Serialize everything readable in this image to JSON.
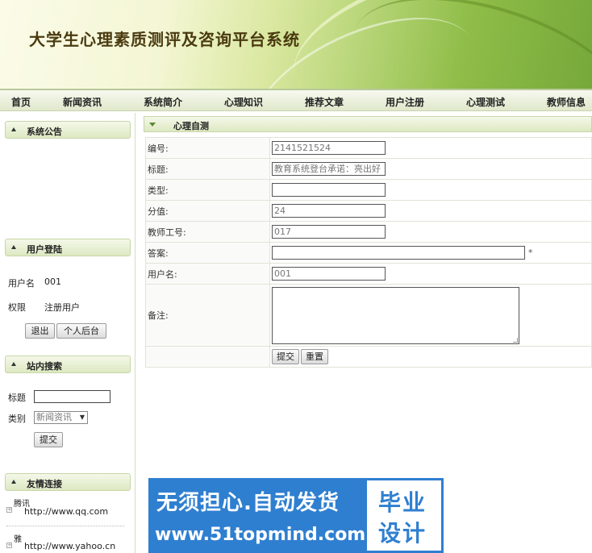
{
  "site": {
    "title": "大学生心理素质测评及咨询平台系统"
  },
  "nav": [
    "首页",
    "新闻资讯",
    "系统简介",
    "心理知识",
    "推荐文章",
    "用户注册",
    "心理测试",
    "教师信息"
  ],
  "sidebar": {
    "notice_title": "系统公告",
    "login_title": "用户登陆",
    "username_label": "用户名",
    "username_value": "001",
    "role_label": "权限",
    "role_value": "注册用户",
    "logout_label": "退出",
    "backend_label": "个人后台",
    "search_title": "站内搜索",
    "search_title_label": "标题",
    "search_category_label": "类别",
    "search_category_value": "新闻资讯",
    "search_submit_label": "提交",
    "links_title": "友情连接",
    "links": [
      {
        "name": "腾讯",
        "url": "http://www.qq.com"
      },
      {
        "name": "雅",
        "url": "http://www.yahoo.cn"
      }
    ]
  },
  "main": {
    "section_title": "心理自测",
    "fields": {
      "id_label": "编号:",
      "id_value": "2141521524",
      "title_label": "标题:",
      "title_value": "教育系统登台承诺：亮出好",
      "type_label": "类型:",
      "type_value": "",
      "score_label": "分值:",
      "score_value": "24",
      "teacher_label": "教师工号:",
      "teacher_value": "017",
      "answer_label": "答案:",
      "answer_value": "",
      "answer_required": "*",
      "user_label": "用户名:",
      "user_value": "001",
      "remark_label": "备注:",
      "remark_value": ""
    },
    "submit_label": "提交",
    "reset_label": "重置"
  },
  "ad": {
    "line1": "无须担心.自动发货",
    "line2": "www.51topmind.com",
    "badge1": "毕业",
    "badge2": "设计"
  },
  "colors": {
    "accent_green": "#8fbd48",
    "header_bg": "#dde9c2",
    "ad_blue": "#2f7fd0"
  }
}
